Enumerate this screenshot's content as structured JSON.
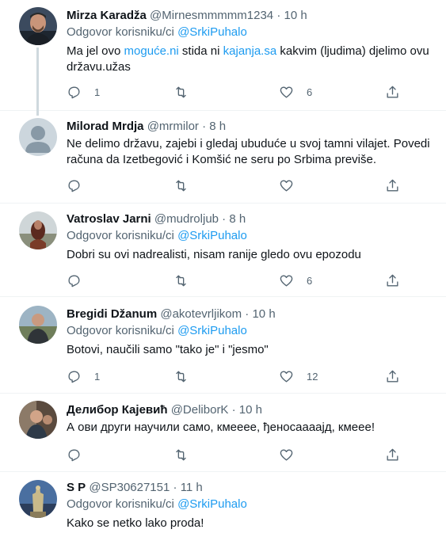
{
  "tweets": [
    {
      "name": "Mirza Karadža",
      "handle": "@Mirnesmmmmm1234",
      "dot": "·",
      "time": "10 h",
      "reply_prefix": "Odgovor korisniku/ci",
      "reply_mention": "@SrkiPuhalo",
      "text_parts": [
        "Ma jel ovo ",
        "moguće.ni",
        " stida ni ",
        "kajanja.sa",
        " kakvim (ljudima) djelimo ovu državu.užas"
      ],
      "replies": "1",
      "retweets": "",
      "likes": "6"
    },
    {
      "name": "Milorad Mrdja",
      "handle": "@mrmilor",
      "dot": "·",
      "time": "8 h",
      "text": "Ne delimo državu, zajebi i gledaj ubuduće u svoj tamni vilajet. Povedi računa da Izetbegović i Komšić ne seru po Srbima previše.",
      "replies": "",
      "retweets": "",
      "likes": ""
    },
    {
      "name": "Vatroslav Jarni",
      "handle": "@mudroljub",
      "dot": "·",
      "time": "8 h",
      "reply_prefix": "Odgovor korisniku/ci",
      "reply_mention": "@SrkiPuhalo",
      "text": "Dobri su ovi nadrealisti, nisam ranije gledo ovu epozodu",
      "replies": "",
      "retweets": "",
      "likes": "6"
    },
    {
      "name": "Bregidi Džanum",
      "handle": "@akotevrljikom",
      "dot": "·",
      "time": "10 h",
      "reply_prefix": "Odgovor korisniku/ci",
      "reply_mention": "@SrkiPuhalo",
      "text": "Botovi, naučili samo \"tako je\" i \"jesmo\"",
      "replies": "1",
      "retweets": "",
      "likes": "12"
    },
    {
      "name": "Делибор Кајевић",
      "handle": "@DeliborK",
      "dot": "·",
      "time": "10 h",
      "text": "А ови други научили само, кмееее, ђеносаааајд, кмеее!",
      "replies": "",
      "retweets": "",
      "likes": ""
    },
    {
      "name": "S P",
      "handle": "@SP30627151",
      "dot": "·",
      "time": "11 h",
      "reply_prefix": "Odgovor korisniku/ci",
      "reply_mention": "@SrkiPuhalo",
      "text": "Kako se netko lako proda!"
    }
  ],
  "icons": {
    "reply": "reply-icon",
    "retweet": "retweet-icon",
    "like": "heart-icon",
    "share": "share-icon"
  },
  "colors": {
    "text": "#0f1419",
    "secondary": "#536471",
    "link": "#1d9bf0",
    "divider": "#eff3f4",
    "thread_line": "#cfd9de"
  }
}
